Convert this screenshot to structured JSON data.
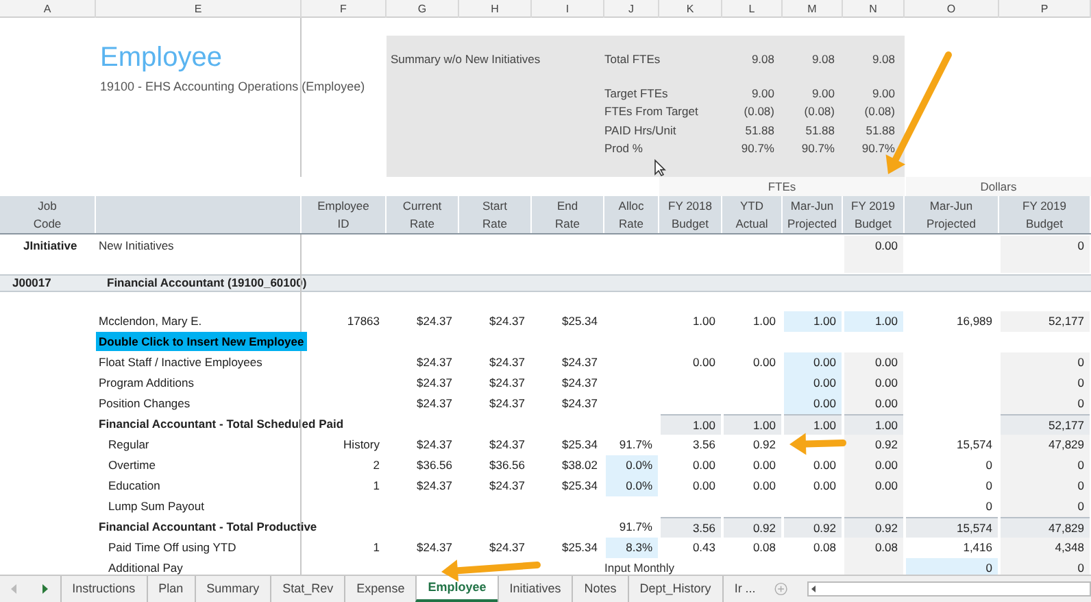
{
  "column_letters": [
    "A",
    "E",
    "F",
    "G",
    "H",
    "I",
    "J",
    "K",
    "L",
    "M",
    "N",
    "O",
    "P"
  ],
  "title": "Employee",
  "subtitle": "19100 - EHS Accounting Operations (Employee)",
  "summary": {
    "title": "Summary w/o New Initiatives",
    "rows": [
      {
        "label": "Total FTEs",
        "values": [
          "9.08",
          "9.08",
          "9.08"
        ]
      },
      {
        "label": "Target FTEs",
        "values": [
          "9.00",
          "9.00",
          "9.00"
        ]
      },
      {
        "label": "FTEs From Target",
        "values": [
          "(0.08)",
          "(0.08)",
          "(0.08)"
        ]
      },
      {
        "label": "PAID Hrs/Unit",
        "values": [
          "51.88",
          "51.88",
          "51.88"
        ]
      },
      {
        "label": "Prod %",
        "values": [
          "90.7%",
          "90.7%",
          "90.7%"
        ]
      }
    ]
  },
  "group_headers": [
    "FTEs",
    "Dollars"
  ],
  "column_headers": [
    "Job\nCode",
    "Employee\nID",
    "Current\nRate",
    "Start\nRate",
    "End\nRate",
    "Alloc\nRate",
    "FY 2018\nBudget",
    "YTD\nActual",
    "Mar-Jun\nProjected",
    "FY 2019\nBudget",
    "Mar-Jun\nProjected",
    "FY 2019\nBudget"
  ],
  "rows": [
    {
      "kind": "initiative",
      "code": "JInitiative",
      "label": "New Initiatives",
      "cells": [
        null,
        null,
        null,
        null,
        null,
        null,
        null,
        null,
        "0.00",
        null,
        "0"
      ]
    },
    {
      "kind": "section",
      "code": "J00017",
      "label": "Financial Accountant (19100_60100)",
      "cells": []
    },
    {
      "kind": "normal",
      "label": "Mcclendon, Mary E.",
      "cells": [
        "17863",
        "$24.37",
        "$24.37",
        "$25.34",
        null,
        "1.00",
        "1.00",
        {
          "text": "1.00",
          "kind": "input"
        },
        {
          "text": "1.00",
          "kind": "input"
        },
        "16,989",
        "52,177"
      ]
    },
    {
      "kind": "action",
      "label": "Double Click to Insert New Employee",
      "cells": []
    },
    {
      "kind": "normal",
      "label": "Float Staff / Inactive Employees",
      "cells": [
        null,
        "$24.37",
        "$24.37",
        "$24.37",
        null,
        "0.00",
        "0.00",
        {
          "text": "0.00",
          "kind": "input"
        },
        "0.00",
        null,
        "0"
      ]
    },
    {
      "kind": "normal",
      "label": "Program Additions",
      "cells": [
        null,
        "$24.37",
        "$24.37",
        "$24.37",
        null,
        null,
        null,
        {
          "text": "0.00",
          "kind": "input"
        },
        "0.00",
        null,
        "0"
      ]
    },
    {
      "kind": "normal",
      "label": "Position Changes",
      "cells": [
        null,
        "$24.37",
        "$24.37",
        "$24.37",
        null,
        null,
        null,
        {
          "text": "0.00",
          "kind": "input"
        },
        "0.00",
        null,
        "0"
      ]
    },
    {
      "kind": "total",
      "label": "Financial Accountant - Total Scheduled Paid",
      "cells": [
        null,
        null,
        null,
        null,
        null,
        "1.00",
        "1.00",
        "1.00",
        "1.00",
        null,
        "52,177"
      ]
    },
    {
      "kind": "sub",
      "label": "Regular",
      "cells": [
        "History",
        "$24.37",
        "$24.37",
        "$25.34",
        "91.7%",
        "3.56",
        "0.92",
        null,
        "0.92",
        "15,574",
        "47,829"
      ]
    },
    {
      "kind": "sub",
      "label": "Overtime",
      "cells": [
        "2",
        "$36.56",
        "$36.56",
        "$38.02",
        {
          "text": "0.0%",
          "kind": "input"
        },
        "0.00",
        "0.00",
        "0.00",
        "0.00",
        "0",
        "0"
      ]
    },
    {
      "kind": "sub",
      "label": "Education",
      "cells": [
        "1",
        "$24.37",
        "$24.37",
        "$25.34",
        {
          "text": "0.0%",
          "kind": "input"
        },
        "0.00",
        "0.00",
        "0.00",
        "0.00",
        "0",
        "0"
      ]
    },
    {
      "kind": "sub",
      "label": "Lump Sum Payout",
      "cells": [
        null,
        null,
        null,
        null,
        null,
        null,
        null,
        null,
        null,
        "0",
        "0"
      ]
    },
    {
      "kind": "total",
      "label": "Financial Accountant - Total Productive",
      "cells": [
        null,
        null,
        null,
        null,
        "91.7%",
        "3.56",
        "0.92",
        "0.92",
        "0.92",
        "15,574",
        "47,829"
      ]
    },
    {
      "kind": "sub",
      "label": "Paid Time Off using YTD",
      "cells": [
        "1",
        "$24.37",
        "$24.37",
        "$25.34",
        {
          "text": "8.3%",
          "kind": "input"
        },
        "0.43",
        "0.08",
        "0.08",
        "0.08",
        "1,416",
        "4,348"
      ]
    },
    {
      "kind": "sub",
      "label": "Additional Pay",
      "cells": [
        null,
        null,
        null,
        null,
        {
          "text": "Input Monthly",
          "kind": "note"
        },
        null,
        null,
        null,
        null,
        {
          "text": "0",
          "kind": "input"
        },
        "0"
      ]
    }
  ],
  "sheet_tabs": [
    {
      "label": "Instructions",
      "selected": false
    },
    {
      "label": "Plan",
      "selected": false
    },
    {
      "label": "Summary",
      "selected": false
    },
    {
      "label": "Stat_Rev",
      "selected": false
    },
    {
      "label": "Expense",
      "selected": false
    },
    {
      "label": "Employee",
      "selected": true
    },
    {
      "label": "Initiatives",
      "selected": false
    },
    {
      "label": "Notes",
      "selected": false
    },
    {
      "label": "Dept_History",
      "selected": false
    },
    {
      "label": "Ir ...",
      "selected": false
    }
  ]
}
